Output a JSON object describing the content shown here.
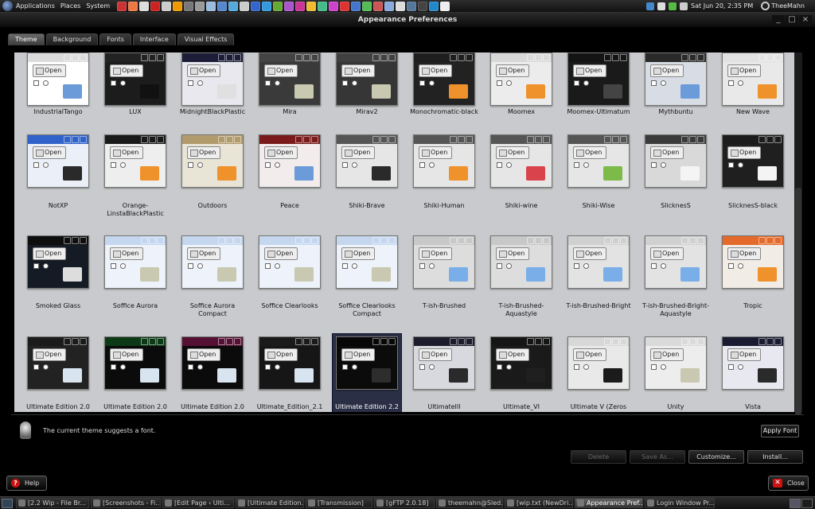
{
  "top_panel": {
    "menus": [
      "Applications",
      "Places",
      "System"
    ],
    "clock": "Sat Jun 20, 2:35 PM",
    "user": "TheeMahn"
  },
  "window": {
    "title": "Appearance Preferences"
  },
  "tabs": [
    {
      "label": "Theme",
      "active": true
    },
    {
      "label": "Background",
      "active": false
    },
    {
      "label": "Fonts",
      "active": false
    },
    {
      "label": "Interface",
      "active": false
    },
    {
      "label": "Visual Effects",
      "active": false
    }
  ],
  "themes": [
    [
      {
        "name": "IndustrialTango",
        "bar": "#dcdcdc",
        "body": "#ffffff",
        "folder": "#6b9bd8"
      },
      {
        "name": "LUX",
        "bar": "#222222",
        "body": "#1c1c1c",
        "folder": "#111111"
      },
      {
        "name": "MidnightBlackPlastic",
        "bar": "#1d1d38",
        "body": "#e8e8ee",
        "folder": "#e0e0e0"
      },
      {
        "name": "Mira",
        "bar": "#444444",
        "body": "#3a3a3a",
        "folder": "#c9c8b0"
      },
      {
        "name": "Mirav2",
        "bar": "#404040",
        "body": "#363636",
        "folder": "#c9c8b0"
      },
      {
        "name": "Monochromatic-black",
        "bar": "#1e1e1e",
        "body": "#222222",
        "folder": "#f0922c"
      },
      {
        "name": "Moomex",
        "bar": "#d8d8d8",
        "body": "#ececec",
        "folder": "#f0922c"
      },
      {
        "name": "Moomex-Ultimatum",
        "bar": "#141414",
        "body": "#1a1a1a",
        "folder": "#444444"
      },
      {
        "name": "Mythbuntu",
        "bar": "#2a2a2a",
        "body": "#d8dde5",
        "folder": "#6b9bd8"
      },
      {
        "name": "New Wave",
        "bar": "#e2e2e2",
        "body": "#e9e9e9",
        "folder": "#f0922c"
      }
    ],
    [
      {
        "name": "NotXP",
        "bar": "#2f63c9",
        "body": "#ebeff8",
        "folder": "#2a2a2a"
      },
      {
        "name": "Orange-\nLinstaBlackPlastic",
        "bar": "#1a1a1a",
        "body": "#eeeeee",
        "folder": "#f0922c"
      },
      {
        "name": "Outdoors",
        "bar": "#b19a6b",
        "body": "#e8e4d6",
        "folder": "#f0922c"
      },
      {
        "name": "Peace",
        "bar": "#7a1a1a",
        "body": "#f2ecec",
        "folder": "#6b9bd8"
      },
      {
        "name": "Shiki-Brave",
        "bar": "#555555",
        "body": "#e6e6e6",
        "folder": "#2a2a2a"
      },
      {
        "name": "Shiki-Human",
        "bar": "#555555",
        "body": "#e6e6e6",
        "folder": "#f0922c"
      },
      {
        "name": "Shiki-wine",
        "bar": "#555555",
        "body": "#e6e6e6",
        "folder": "#d9434b"
      },
      {
        "name": "Shiki-Wise",
        "bar": "#555555",
        "body": "#e6e6e6",
        "folder": "#7cbb4a"
      },
      {
        "name": "SlicknesS",
        "bar": "#3a3a3a",
        "body": "#d9d9d9",
        "folder": "#f4f4f4"
      },
      {
        "name": "SlicknesS-black",
        "bar": "#1c1c1c",
        "body": "#1f1f1f",
        "folder": "#f4f4f4"
      }
    ],
    [
      {
        "name": "Smoked Glass",
        "bar": "#0e0e0e",
        "body": "#151b24",
        "folder": "#dddddd"
      },
      {
        "name": "Soffice Aurora",
        "bar": "#c5d7ef",
        "body": "#eef3fb",
        "folder": "#c9c8b0"
      },
      {
        "name": "Soffice Aurora\nCompact",
        "bar": "#c5d7ef",
        "body": "#eef3fb",
        "folder": "#c9c8b0"
      },
      {
        "name": "Soffice Clearlooks",
        "bar": "#c5d7ef",
        "body": "#eef3fb",
        "folder": "#c9c8b0"
      },
      {
        "name": "Soffice Clearlooks\nCompact",
        "bar": "#c5d7ef",
        "body": "#eef3fb",
        "folder": "#c9c8b0"
      },
      {
        "name": "T-ish-Brushed",
        "bar": "#c8c8c8",
        "body": "#dddddd",
        "folder": "#79aee9"
      },
      {
        "name": "T-ish-Brushed-\nAquastyle",
        "bar": "#c8c8c8",
        "body": "#dddddd",
        "folder": "#79aee9"
      },
      {
        "name": "T-ish-Brushed-Bright",
        "bar": "#d0d0d0",
        "body": "#e3e3e3",
        "folder": "#79aee9"
      },
      {
        "name": "T-ish-Brushed-Bright-\nAquastyle",
        "bar": "#d0d0d0",
        "body": "#e3e3e3",
        "folder": "#79aee9"
      },
      {
        "name": "Tropic",
        "bar": "#e36a2a",
        "body": "#f2ece6",
        "folder": "#f0922c"
      }
    ],
    [
      {
        "name": "Ultimate Edition 2.0",
        "bar": "#1b1b1b",
        "body": "#222222",
        "folder": "#d8e4ef"
      },
      {
        "name": "Ultimate Edition 2.0",
        "bar": "#0c3a16",
        "body": "#0b0b0b",
        "folder": "#d8e4ef"
      },
      {
        "name": "Ultimate Edition 2.0",
        "bar": "#551133",
        "body": "#0b0b0b",
        "folder": "#d8e4ef"
      },
      {
        "name": "Ultimate_Edition_2.1",
        "bar": "#1a1a1a",
        "body": "#161616",
        "folder": "#d8e4ef"
      },
      {
        "name": "Ultimate Edition 2.2",
        "bar": "#070707",
        "body": "#0b0b0b",
        "folder": "#2d2d2d"
      },
      {
        "name": "UltimateIII",
        "bar": "#1c1c2c",
        "body": "#d8d8df",
        "folder": "#2a2a2a"
      },
      {
        "name": "Ultimate_VI",
        "bar": "#151515",
        "body": "#1a1a1a",
        "folder": "#1f1f1f"
      },
      {
        "name": "Ultimate V (Zeros",
        "bar": "#d8d8d8",
        "body": "#e9e9e9",
        "folder": "#1b1b1b"
      },
      {
        "name": "Unity",
        "bar": "#dadada",
        "body": "#ededed",
        "folder": "#c9c8b0"
      },
      {
        "name": "Vista",
        "bar": "#1a1a30",
        "body": "#e8e8f0",
        "folder": "#2a2a2a"
      }
    ]
  ],
  "selected_theme": "Ultimate Edition 2.2",
  "open_label": "Open",
  "info": {
    "message": "The current theme suggests a font.",
    "apply_font": "Apply Font"
  },
  "actions": {
    "delete": "Delete",
    "save_as": "Save As...",
    "customize": "Customize...",
    "install": "Install..."
  },
  "help": "Help",
  "close": "Close",
  "taskbar": [
    {
      "label": "[2.2 Wip - File Br...",
      "active": false
    },
    {
      "label": "[Screenshots - Fi...",
      "active": false
    },
    {
      "label": "[Edit Page ‹ Ulti...",
      "active": false
    },
    {
      "label": "[Ultimate Edition...",
      "active": false
    },
    {
      "label": "[Transmission]",
      "active": false
    },
    {
      "label": "[gFTP 2.0.18]",
      "active": false
    },
    {
      "label": "theemahn@Sled...",
      "active": false
    },
    {
      "label": "[wip.txt (NewDri...",
      "active": false
    },
    {
      "label": "Appearance Pref...",
      "active": true
    },
    {
      "label": "Login Window Pr...",
      "active": false
    }
  ]
}
